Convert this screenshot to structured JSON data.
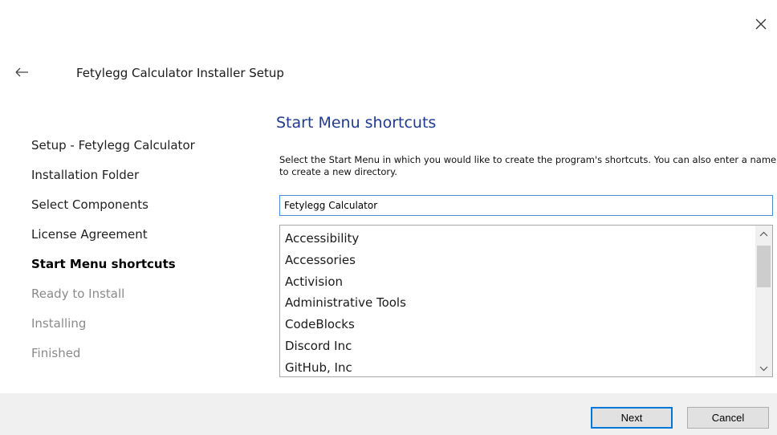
{
  "window": {
    "title": "Fetylegg Calculator Installer Setup"
  },
  "icons": {
    "close": "close-icon",
    "back": "back-arrow-icon",
    "scroll_up": "chevron-up-icon",
    "scroll_down": "chevron-down-icon"
  },
  "steps": [
    {
      "label": "Setup - Fetylegg Calculator",
      "state": "done"
    },
    {
      "label": "Installation Folder",
      "state": "done"
    },
    {
      "label": "Select Components",
      "state": "done"
    },
    {
      "label": "License Agreement",
      "state": "done"
    },
    {
      "label": "Start Menu shortcuts",
      "state": "current"
    },
    {
      "label": "Ready to Install",
      "state": "pending"
    },
    {
      "label": "Installing",
      "state": "pending"
    },
    {
      "label": "Finished",
      "state": "pending"
    }
  ],
  "page": {
    "heading": "Start Menu shortcuts",
    "description": "Select the Start Menu in which you would like to create the program's shortcuts. You can also enter a name to create a new directory.",
    "input_value": "Fetylegg Calculator"
  },
  "folders": [
    "Accessibility",
    "Accessories",
    "Activision",
    "Administrative Tools",
    "CodeBlocks",
    "Discord Inc",
    "GitHub, Inc"
  ],
  "buttons": {
    "next": "Next",
    "cancel": "Cancel"
  },
  "colors": {
    "heading": "#1f3b8f",
    "accent": "#0078d7",
    "footer": "#f0f0f0",
    "pending_step": "#8a8a8a"
  }
}
